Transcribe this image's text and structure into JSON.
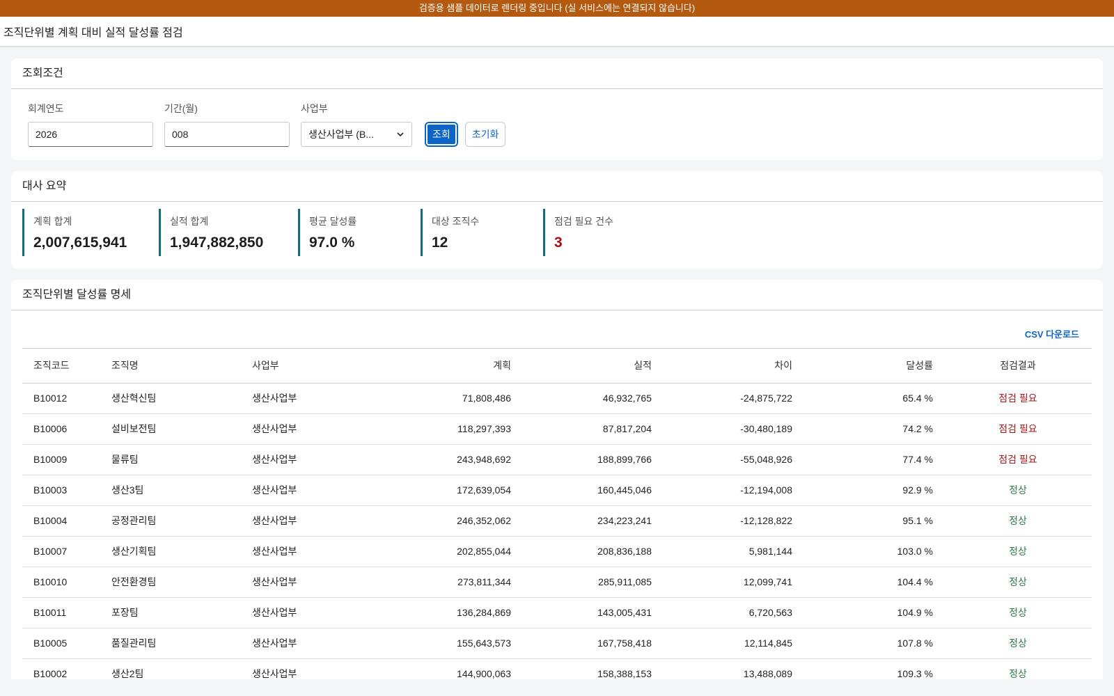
{
  "banner": "검증용 샘플 데이터로 렌더링 중입니다 (실 서비스에는 연결되지 않습니다)",
  "page_title": "조직단위별 계획 대비 실적 달성률 점검",
  "search": {
    "title": "조회조건",
    "year_label": "회계연도",
    "year_value": "2026",
    "period_label": "기간(월)",
    "period_value": "008",
    "division_label": "사업부",
    "division_value": "생산사업부 (B...",
    "search_button": "조회",
    "reset_button": "초기화"
  },
  "summary": {
    "title": "대사 요약",
    "kpis": [
      {
        "label": "계획 합계",
        "value": "2,007,615,941"
      },
      {
        "label": "실적 합계",
        "value": "1,947,882,850"
      },
      {
        "label": "평균 달성률",
        "value": "97.0 %"
      },
      {
        "label": "대상 조직수",
        "value": "12"
      },
      {
        "label": "점검 필요 건수",
        "value": "3"
      }
    ]
  },
  "detail": {
    "title": "조직단위별 달성률 명세",
    "csv_button": "CSV 다운로드",
    "columns": [
      "조직코드",
      "조직명",
      "사업부",
      "계획",
      "실적",
      "차이",
      "달성률",
      "점검결과"
    ],
    "rows": [
      [
        "B10012",
        "생산혁신팀",
        "생산사업부",
        "71,808,486",
        "46,932,765",
        "-24,875,722",
        "65.4 %",
        "점검 필요"
      ],
      [
        "B10006",
        "설비보전팀",
        "생산사업부",
        "118,297,393",
        "87,817,204",
        "-30,480,189",
        "74.2 %",
        "점검 필요"
      ],
      [
        "B10009",
        "물류팀",
        "생산사업부",
        "243,948,692",
        "188,899,766",
        "-55,048,926",
        "77.4 %",
        "점검 필요"
      ],
      [
        "B10003",
        "생산3팀",
        "생산사업부",
        "172,639,054",
        "160,445,046",
        "-12,194,008",
        "92.9 %",
        "정상"
      ],
      [
        "B10004",
        "공정관리팀",
        "생산사업부",
        "246,352,062",
        "234,223,241",
        "-12,128,822",
        "95.1 %",
        "정상"
      ],
      [
        "B10007",
        "생산기획팀",
        "생산사업부",
        "202,855,044",
        "208,836,188",
        "5,981,144",
        "103.0 %",
        "정상"
      ],
      [
        "B10010",
        "안전환경팀",
        "생산사업부",
        "273,811,344",
        "285,911,085",
        "12,099,741",
        "104.4 %",
        "정상"
      ],
      [
        "B10011",
        "포장팀",
        "생산사업부",
        "136,284,869",
        "143,005,431",
        "6,720,563",
        "104.9 %",
        "정상"
      ],
      [
        "B10005",
        "품질관리팀",
        "생산사업부",
        "155,643,573",
        "167,758,418",
        "12,114,845",
        "107.8 %",
        "정상"
      ],
      [
        "B10002",
        "생산2팀",
        "생산사업부",
        "144,900,063",
        "158,388,153",
        "13,488,089",
        "109.3 %",
        "정상"
      ]
    ]
  },
  "colors": {
    "banner": "#b35a10",
    "accent": "#0b64c6",
    "kpi_bar": "#0f6e73",
    "danger": "#a3161a",
    "ok": "#2e7a47"
  }
}
